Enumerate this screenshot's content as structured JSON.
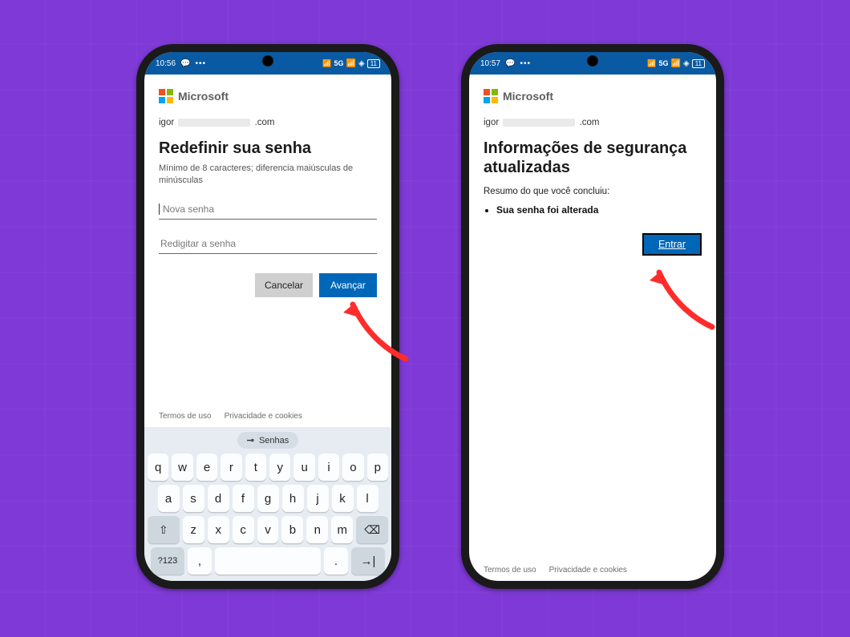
{
  "statusbar": {
    "time_left": "10:56",
    "time_right": "10:57",
    "network": "5G",
    "signal_prefix": "5G"
  },
  "brand": {
    "name": "Microsoft"
  },
  "account": {
    "prefix": "igor",
    "suffix": ".com"
  },
  "left_screen": {
    "title": "Redefinir sua senha",
    "subtitle": "Mínimo de 8 caracteres; diferencia maiúsculas de minúsculas",
    "placeholder_new": "Nova senha",
    "placeholder_repeat": "Redigitar a senha",
    "cancel": "Cancelar",
    "advance": "Avançar"
  },
  "right_screen": {
    "title": "Informações de segurança atualizadas",
    "summary_label": "Resumo do que você concluiu:",
    "done_item": "Sua senha foi alterada",
    "enter": "Entrar"
  },
  "footer": {
    "terms": "Termos de uso",
    "privacy": "Privacidade e cookies"
  },
  "keyboard": {
    "pill": "Senhas",
    "row1": [
      "q",
      "w",
      "e",
      "r",
      "t",
      "y",
      "u",
      "i",
      "o",
      "p"
    ],
    "row2": [
      "a",
      "s",
      "d",
      "f",
      "g",
      "h",
      "j",
      "k",
      "l"
    ],
    "row3": [
      "z",
      "x",
      "c",
      "v",
      "b",
      "n",
      "m"
    ],
    "sym": "?123",
    "comma": ",",
    "dot": "."
  }
}
